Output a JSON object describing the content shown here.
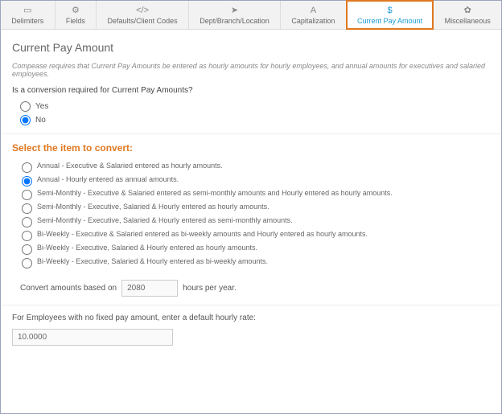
{
  "tabs": [
    {
      "icon": "▭",
      "label": "Delimiters"
    },
    {
      "icon": "⚙",
      "label": "Fields"
    },
    {
      "icon": "</>",
      "label": "Defaults/Client Codes"
    },
    {
      "icon": "➤",
      "label": "Dept/Branch/Location"
    },
    {
      "icon": "A",
      "label": "Capitalization"
    },
    {
      "icon": "$",
      "label": "Current Pay Amount"
    },
    {
      "icon": "✿",
      "label": "Miscellaneous"
    }
  ],
  "page_title": "Current Pay Amount",
  "intro": "Compease requires that Current Pay Amounts be entered as hourly amounts for hourly employees, and annual amounts for executives and salaried employees.",
  "conversion_question": "Is a conversion required for Current Pay Amounts?",
  "yes_label": "Yes",
  "no_label": "No",
  "section_title": "Select the item to convert:",
  "options": [
    "Annual - Executive & Salaried entered as hourly amounts.",
    "Annual - Hourly entered as annual amounts.",
    "Semi-Monthly - Executive & Salaried entered as semi-monthly amounts and Hourly entered as hourly amounts.",
    "Semi-Monthly - Executive, Salaried & Hourly entered as hourly amounts.",
    "Semi-Monthly - Executive, Salaried & Hourly entered as semi-monthly amounts.",
    "Bi-Weekly - Executive & Salaried entered as bi-weekly amounts and Hourly entered as hourly amounts.",
    "Bi-Weekly - Executive, Salaried & Hourly entered as hourly amounts.",
    "Bi-Weekly - Executive, Salaried & Hourly entered as bi-weekly amounts."
  ],
  "convert_prefix": "Convert amounts based on",
  "convert_value": "2080",
  "convert_suffix": "hours per year.",
  "default_rate_label": "For Employees with no fixed pay amount, enter a default hourly rate:",
  "default_rate_value": "10.0000"
}
